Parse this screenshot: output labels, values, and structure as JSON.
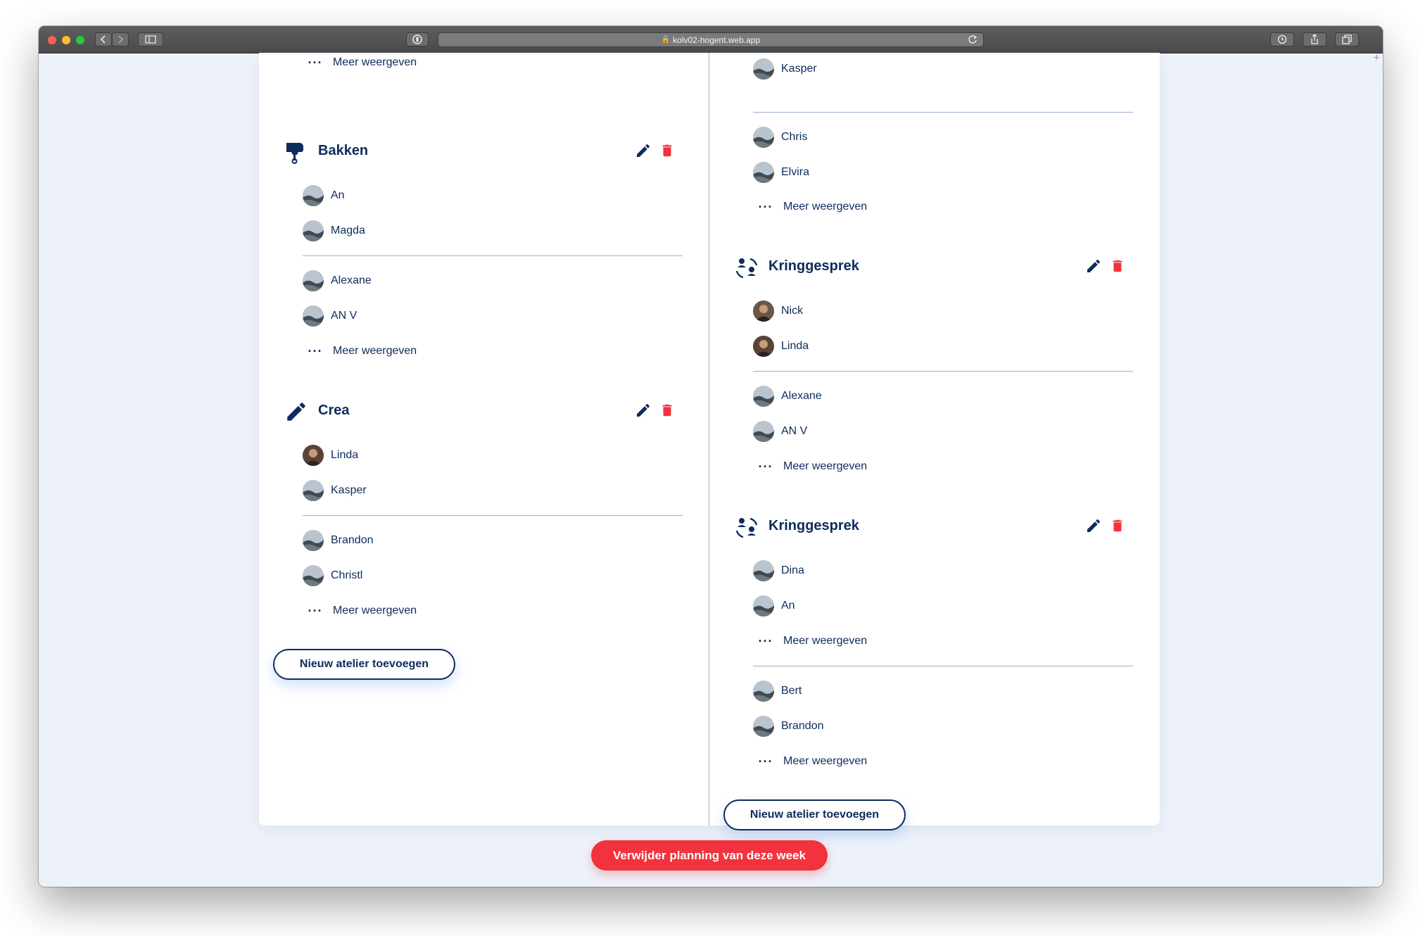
{
  "browser": {
    "url": "kolv02-hogent.web.app",
    "icons": {
      "back": "chevron-left-icon",
      "forward": "chevron-right-icon",
      "sidebar": "sidebar-icon",
      "privacy": "privacy-report-icon",
      "reload": "reload-icon",
      "history": "history-icon",
      "share": "share-icon",
      "tabs": "tabs-icon",
      "new_tab": "+"
    }
  },
  "colors": {
    "primary": "#0d2c5c",
    "danger": "#f2323d",
    "page_bg": "#edf2fa",
    "divider": "#9bb1cc"
  },
  "left_column": {
    "top_more_label": "Meer weergeven",
    "sections": [
      {
        "title": "Bakken",
        "icon": "mixer-icon",
        "group_a": [
          "An",
          "Magda"
        ],
        "group_b": [
          "Alexane",
          "AN V"
        ],
        "more_b": "Meer weergeven"
      },
      {
        "title": "Crea",
        "icon": "pencil-icon",
        "group_a": [
          "Linda",
          "Kasper"
        ],
        "group_b": [
          "Brandon",
          "Christl"
        ],
        "more_b": "Meer weergeven"
      }
    ],
    "add_label": "Nieuw atelier toevoegen"
  },
  "right_column": {
    "top_person": "Kasper",
    "top_group_b": [
      "Chris",
      "Elvira"
    ],
    "top_more_label": "Meer weergeven",
    "sections": [
      {
        "title": "Kringgesprek",
        "icon": "circle-talk-icon",
        "group_a": [
          "Nick",
          "Linda"
        ],
        "group_b": [
          "Alexane",
          "AN V"
        ],
        "more_b": "Meer weergeven"
      },
      {
        "title": "Kringgesprek",
        "icon": "circle-talk-icon",
        "group_a": [
          "Dina",
          "An"
        ],
        "more_a": "Meer weergeven",
        "group_b": [
          "Bert",
          "Brandon"
        ],
        "more_b": "Meer weergeven"
      }
    ],
    "add_label": "Nieuw atelier toevoegen"
  },
  "footer": {
    "delete_week_label": "Verwijder planning van deze week"
  }
}
